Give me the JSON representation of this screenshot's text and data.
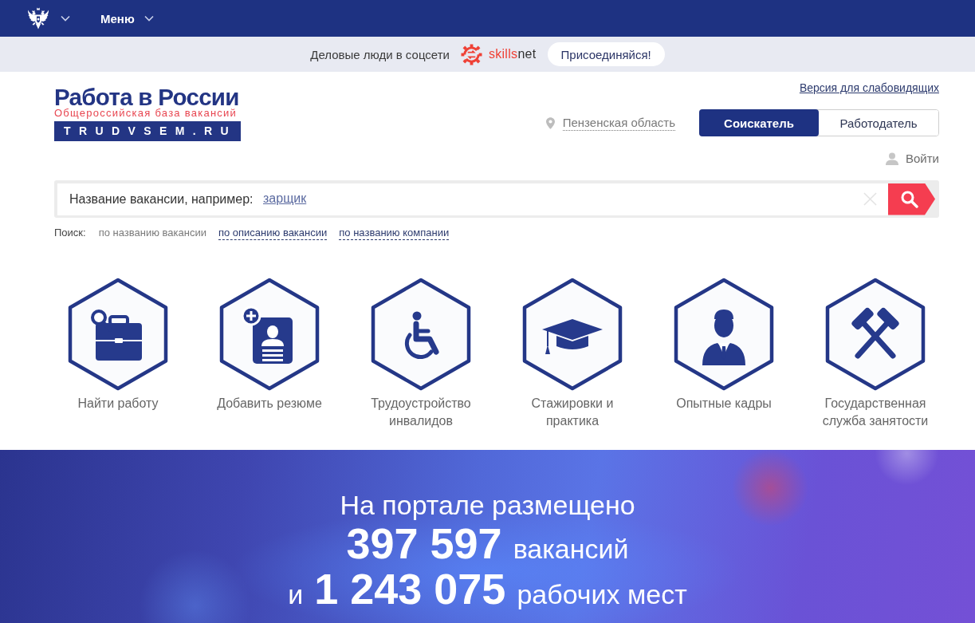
{
  "top_bar": {
    "menu": "Меню"
  },
  "promo": {
    "text": "Деловые люди в соцсети",
    "brand": {
      "lead": "skills",
      "tail": "net"
    },
    "button": "Присоединяйся!"
  },
  "header": {
    "logo": {
      "title": "Работа в России",
      "subtitle": "Общероссийская база вакансий",
      "domain": "TRUDVSEM.RU"
    },
    "accessibility_link": "Версия для слабовидящих",
    "region": "Пензенская область",
    "role_tabs": [
      {
        "label": "Соискатель",
        "selected": true
      },
      {
        "label": "Работодатель",
        "selected": false
      }
    ],
    "login": "Войти"
  },
  "search": {
    "placeholder": "Название вакансии, например:",
    "example": "зарщик",
    "modes_label": "Поиск:",
    "modes": [
      {
        "label": "по названию вакансии",
        "selected": true
      },
      {
        "label": "по описанию вакансии",
        "selected": false
      },
      {
        "label": "по названию компании",
        "selected": false
      }
    ]
  },
  "services": [
    {
      "kind": "briefcase",
      "label": "Найти работу"
    },
    {
      "kind": "resume",
      "label": "Добавить резюме"
    },
    {
      "kind": "wheelchair",
      "label": "Трудоустройство инвалидов"
    },
    {
      "kind": "cap",
      "label": "Стажировки и практика"
    },
    {
      "kind": "person",
      "label": "Опытные кадры"
    },
    {
      "kind": "hammers",
      "label": "Государственная служба занятости"
    }
  ],
  "stats": {
    "heading": "На портале размещено",
    "lines": [
      {
        "count": "397 597",
        "unit": "вакансий"
      },
      {
        "prefix": "и",
        "count": "1 243 075",
        "unit": "рабочих мест"
      }
    ]
  }
}
